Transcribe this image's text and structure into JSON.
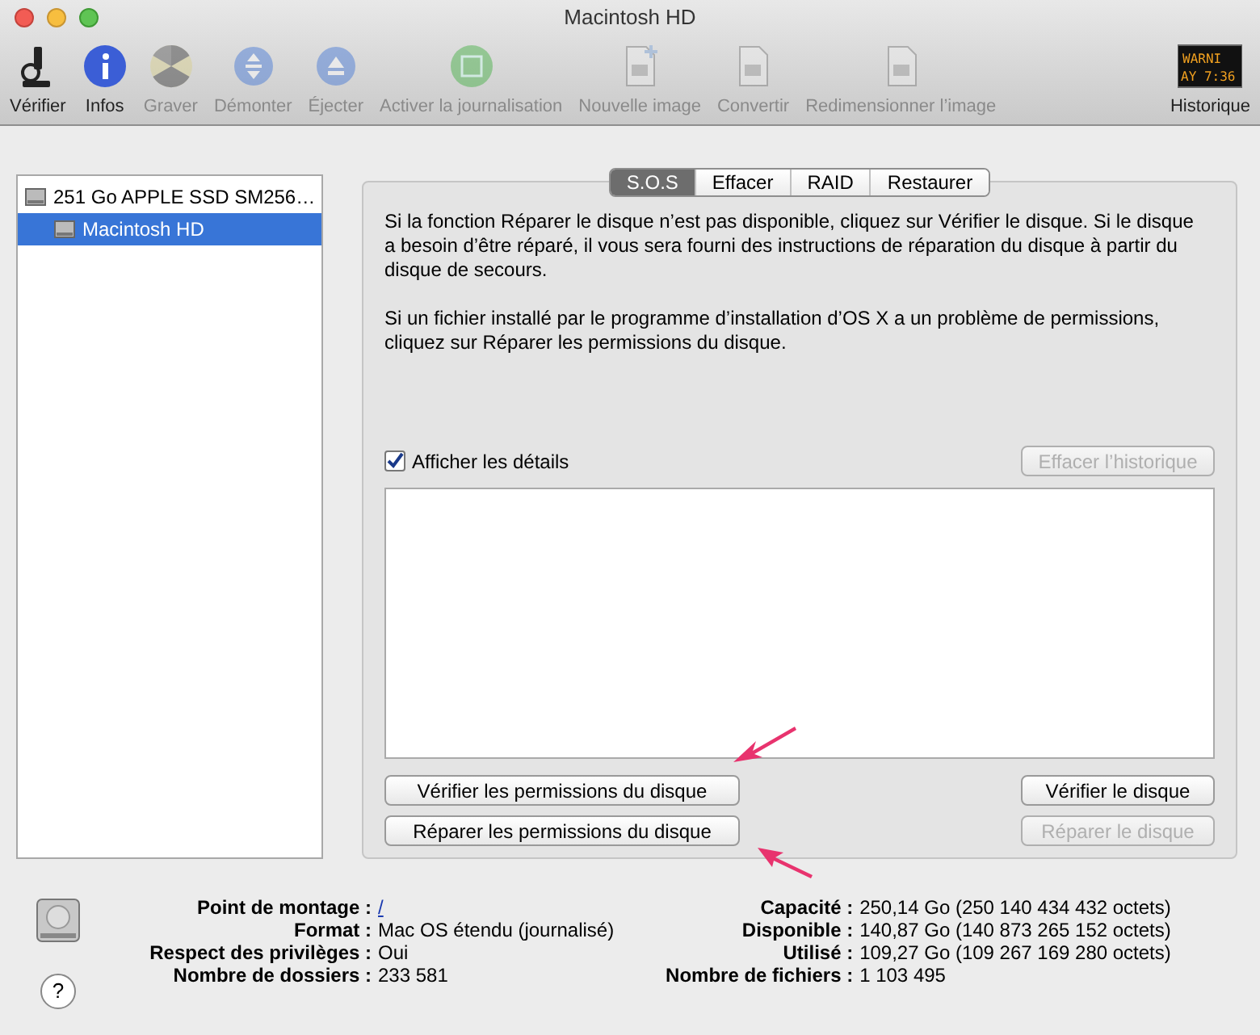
{
  "window": {
    "title": "Macintosh HD"
  },
  "toolbar": [
    {
      "kind": "microscope",
      "label": "Vérifier",
      "disabled": false
    },
    {
      "kind": "info",
      "label": "Infos",
      "disabled": false
    },
    {
      "kind": "burn",
      "label": "Graver",
      "disabled": true
    },
    {
      "kind": "unmount",
      "label": "Démonter",
      "disabled": true
    },
    {
      "kind": "eject",
      "label": "Éjecter",
      "disabled": true
    },
    {
      "kind": "journal",
      "label": "Activer la journalisation",
      "disabled": true
    },
    {
      "kind": "newimage",
      "label": "Nouvelle image",
      "disabled": true
    },
    {
      "kind": "convert",
      "label": "Convertir",
      "disabled": true
    },
    {
      "kind": "resize",
      "label": "Redimensionner l’image",
      "disabled": true
    },
    {
      "kind": "log",
      "label": "Historique",
      "disabled": false,
      "screen": [
        "WARNI",
        "AY 7:36"
      ]
    }
  ],
  "sidebar": {
    "items": [
      {
        "label": "251 Go APPLE SSD SM256…",
        "selected": false,
        "children": [
          {
            "label": "Macintosh HD",
            "selected": true
          }
        ]
      }
    ]
  },
  "tabs": [
    {
      "label": "S.O.S",
      "selected": true
    },
    {
      "label": "Effacer",
      "selected": false
    },
    {
      "label": "RAID",
      "selected": false
    },
    {
      "label": "Restaurer",
      "selected": false
    }
  ],
  "paragraphs": [
    "Si la fonction Réparer le disque n’est pas disponible, cliquez sur Vérifier le disque. Si le disque a besoin d’être réparé, il vous sera fourni des instructions de réparation du disque à partir du disque de secours.",
    "Si un fichier installé par le programme d’installation d’OS X a un problème de permissions, cliquez sur Réparer les permissions du disque."
  ],
  "show_details": {
    "label": "Afficher les détails",
    "checked": true
  },
  "clear_history": {
    "label": "Effacer l’historique",
    "disabled": true
  },
  "actions": [
    {
      "label": "Vérifier les permissions du disque",
      "disabled": false
    },
    {
      "label": "Vérifier le disque",
      "disabled": false
    },
    {
      "label": "Réparer les permissions du disque",
      "disabled": false
    },
    {
      "label": "Réparer le disque",
      "disabled": true
    }
  ],
  "info_left": [
    {
      "label": "Point de montage :",
      "value": "/",
      "kind": "link"
    },
    {
      "label": "Format :",
      "value": "Mac OS étendu (journalisé)",
      "kind": "text"
    },
    {
      "label": "Respect des privilèges :",
      "value": "Oui",
      "kind": "text"
    },
    {
      "label": "Nombre de dossiers :",
      "value": "233 581",
      "kind": "text"
    }
  ],
  "info_right": [
    {
      "label": "Capacité :",
      "value": "250,14 Go (250 140 434 432 octets)"
    },
    {
      "label": "Disponible :",
      "value": "140,87 Go (140 873 265 152 octets)"
    },
    {
      "label": "Utilisé :",
      "value": "109,27 Go (109 267 169 280 octets)"
    },
    {
      "label": "Nombre de fichiers :",
      "value": "1 103 495"
    }
  ],
  "help": {
    "label": "?"
  }
}
